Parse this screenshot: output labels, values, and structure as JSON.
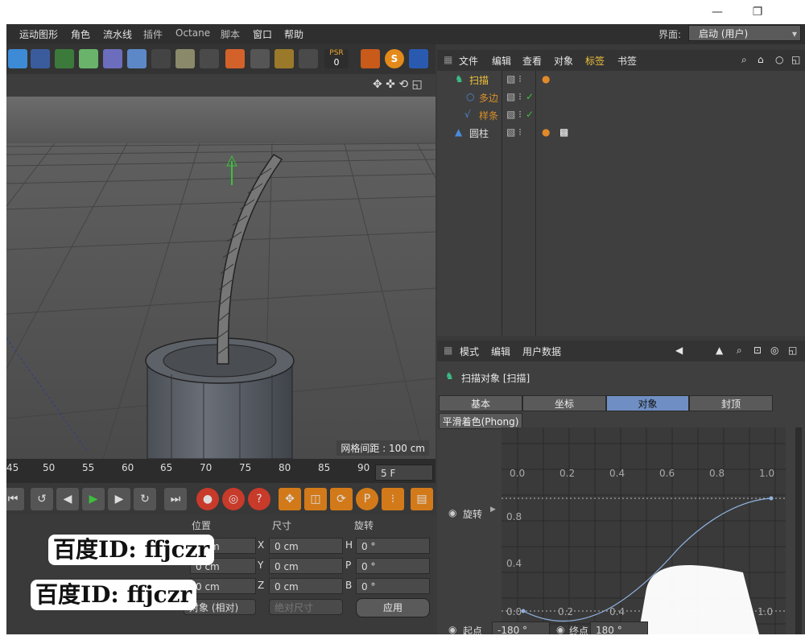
{
  "window": {
    "maximize_glyph": "❐",
    "minimize_glyph": "—"
  },
  "menubar": {
    "items": [
      "运动图形",
      "角色",
      "流水线",
      "插件",
      "Octane",
      "脚本",
      "窗口",
      "帮助"
    ],
    "layout_label": "界面:",
    "layout_value": "启动 (用户)"
  },
  "toolbar": {
    "psr_label": "PSR",
    "psr_value": "0"
  },
  "viewport": {
    "grid_spacing": "网格间距 : 100 cm"
  },
  "timeline": {
    "ticks": [
      "45",
      "50",
      "55",
      "60",
      "65",
      "70",
      "75",
      "80",
      "85",
      "90"
    ],
    "current_frame": "5 F"
  },
  "coordinates": {
    "headers": {
      "position": "位置",
      "size": "尺寸",
      "rotation": "旋转"
    },
    "rows": [
      {
        "pos_axis": "X",
        "pos": "0 cm",
        "size_axis": "X",
        "size": "0 cm",
        "rot_axis": "H",
        "rot": "0 °"
      },
      {
        "pos_axis": "Y",
        "pos": "0 cm",
        "size_axis": "Y",
        "size": "0 cm",
        "rot_axis": "P",
        "rot": "0 °"
      },
      {
        "pos_axis": "Z",
        "pos": "0 cm",
        "size_axis": "Z",
        "size": "0 cm",
        "rot_axis": "B",
        "rot": "0 °"
      }
    ],
    "mode": "对象 (相对)",
    "size_mode": "绝对尺寸",
    "apply": "应用"
  },
  "watermarks": [
    "百度ID: ffjczr",
    "百度ID: ffjczr"
  ],
  "object_manager": {
    "menu": [
      "文件",
      "编辑",
      "查看",
      "对象",
      "标签",
      "书签"
    ],
    "objects": [
      {
        "name": "扫描",
        "color": "#f0c23a"
      },
      {
        "name": "多边",
        "color": "#d98f2a"
      },
      {
        "name": "样条",
        "color": "#d98f2a"
      },
      {
        "name": "圆柱",
        "color": "#e0e0e0"
      }
    ]
  },
  "attributes": {
    "menu": [
      "模式",
      "编辑",
      "用户数据"
    ],
    "object_title": "扫描对象 [扫描]",
    "tabs": [
      "基本",
      "坐标",
      "对象",
      "封顶"
    ],
    "active_tab": "对象",
    "phong": "平滑着色(Phong)",
    "rotation_label": "旋转",
    "spline_x_ticks": [
      "0.0",
      "0.2",
      "0.4",
      "0.6",
      "0.8",
      "1.0"
    ],
    "spline_y_ticks": [
      "0.8",
      "0.4",
      "0.0"
    ],
    "spline_bottom_ticks": [
      "0.0",
      "0.2",
      "0.4",
      "1.0"
    ],
    "start_label": "起点",
    "start_value": "-180 °",
    "end_label": "终点",
    "end_value": "180 °",
    "colors": {
      "active_tab": "#6f8fc4",
      "accent_orange": "#f0a830"
    }
  }
}
